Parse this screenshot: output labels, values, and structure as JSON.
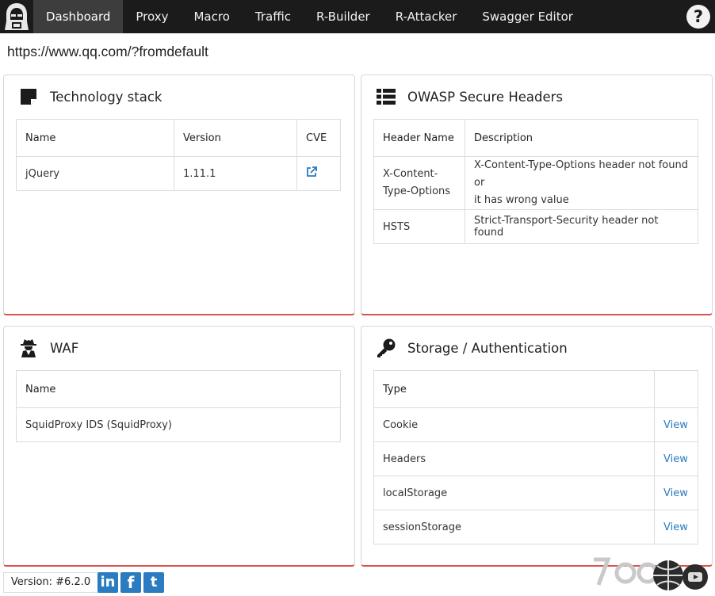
{
  "nav": {
    "items": [
      "Dashboard",
      "Proxy",
      "Macro",
      "Traffic",
      "R-Builder",
      "R-Attacker",
      "Swagger Editor"
    ],
    "active": "Dashboard",
    "help_label": "?"
  },
  "url": "https://www.qq.com/?fromdefault",
  "tech_stack": {
    "title": "Technology stack",
    "headers": [
      "Name",
      "Version",
      "CVE"
    ],
    "rows": [
      {
        "name": "jQuery",
        "version": "1.11.1"
      }
    ]
  },
  "owasp": {
    "title": "OWASP Secure Headers",
    "headers": [
      "Header Name",
      "Description"
    ],
    "rows": [
      {
        "name_l1": "X-Content-",
        "name_l2": "Type-Options",
        "desc_l1": "X-Content-Type-Options header not found or",
        "desc_l2": "it has wrong value"
      },
      {
        "name": "HSTS",
        "desc": "Strict-Transport-Security header not found"
      }
    ]
  },
  "waf": {
    "title": "WAF",
    "headers": [
      "Name"
    ],
    "rows": [
      "SquidProxy IDS (SquidProxy)"
    ]
  },
  "storage": {
    "title": "Storage / Authentication",
    "headers": [
      "Type",
      ""
    ],
    "rows": [
      "Cookie",
      "Headers",
      "localStorage",
      "sessionStorage"
    ],
    "view_label": "View"
  },
  "footer": {
    "version": "Version: #6.2.0",
    "social": [
      "in",
      "f",
      "t"
    ]
  },
  "icons": {
    "logo": "hacker-hood-icon",
    "tech": "sticky-note-icon",
    "owasp": "list-icon",
    "waf": "user-secret-icon",
    "storage": "key-icon",
    "cve": "external-link-icon"
  },
  "colors": {
    "topbar": "#1b1b1b",
    "active_tab": "#3d3d3d",
    "link": "#2a7bbf",
    "panel_accent": "#d9534f"
  }
}
